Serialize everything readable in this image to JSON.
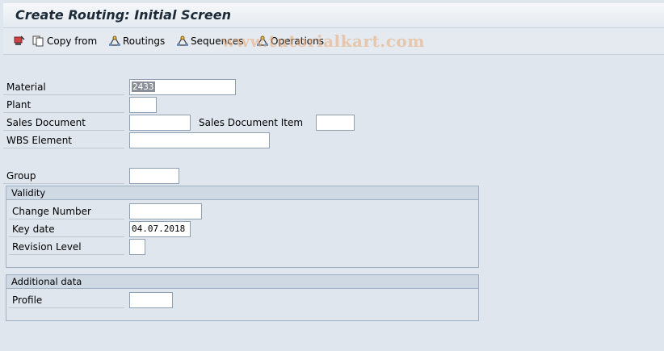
{
  "title": "Create Routing: Initial Screen",
  "toolbar": {
    "copy_from": "Copy from",
    "routings": "Routings",
    "sequences": "Sequences",
    "operations": "Operations"
  },
  "watermark": "www.tutorialkart.com",
  "form": {
    "material_label": "Material",
    "material_value": "2433",
    "plant_label": "Plant",
    "plant_value": "",
    "sales_document_label": "Sales Document",
    "sales_document_value": "",
    "sales_document_item_label": "Sales Document Item",
    "sales_document_item_value": "",
    "wbs_element_label": "WBS Element",
    "wbs_element_value": "",
    "group_label": "Group",
    "group_value": ""
  },
  "validity": {
    "title": "Validity",
    "change_number_label": "Change Number",
    "change_number_value": "",
    "key_date_label": "Key date",
    "key_date_value": "04.07.2018",
    "revision_level_label": "Revision Level",
    "revision_level_value": ""
  },
  "additional": {
    "title": "Additional data",
    "profile_label": "Profile",
    "profile_value": ""
  }
}
